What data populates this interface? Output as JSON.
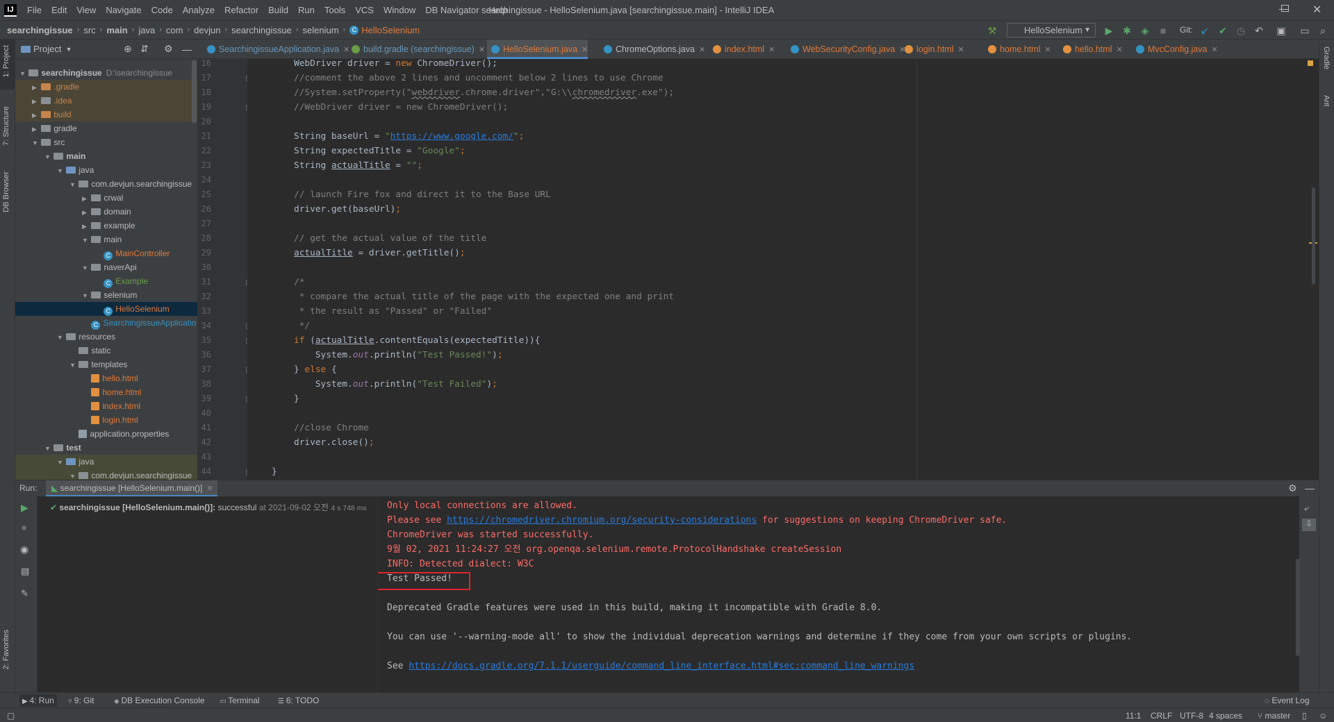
{
  "menu": [
    "File",
    "Edit",
    "View",
    "Navigate",
    "Code",
    "Analyze",
    "Refactor",
    "Build",
    "Run",
    "Tools",
    "VCS",
    "Window",
    "DB Navigator",
    "Help"
  ],
  "window_title": "searchingissue - HelloSelenium.java [searchingissue.main] - IntelliJ IDEA",
  "breadcrumbs": [
    "searchingissue",
    "src",
    "main",
    "java",
    "com",
    "devjun",
    "searchingissue",
    "selenium",
    "HelloSelenium"
  ],
  "run_config": "HelloSelenium",
  "git_label": "Git:",
  "left_strip": {
    "project": "1: Project",
    "structure": "7: Structure",
    "db": "DB Browser",
    "favorites": "2: Favorites"
  },
  "right_strip": {
    "gradle": "Gradle",
    "ant": "Ant"
  },
  "project_panel": {
    "title": "Project"
  },
  "tree": [
    {
      "label": "searchingissue",
      "extra": "D:\\searchingissue",
      "icon": "folder",
      "arrow": "▼",
      "indent": 0,
      "bold": true
    },
    {
      "label": ".gradle",
      "icon": "folder-orange",
      "arrow": "▶",
      "indent": 1,
      "color": "#c6854d",
      "bg": "orange"
    },
    {
      "label": ".idea",
      "icon": "folder",
      "arrow": "▶",
      "indent": 1,
      "color": "#c6854d",
      "bg": "orange"
    },
    {
      "label": "build",
      "icon": "folder-orange",
      "arrow": "▶",
      "indent": 1,
      "color": "#c6854d",
      "bg": "orange"
    },
    {
      "label": "gradle",
      "icon": "folder",
      "arrow": "▶",
      "indent": 1
    },
    {
      "label": "src",
      "icon": "folder",
      "arrow": "▼",
      "indent": 1
    },
    {
      "label": "main",
      "icon": "folder",
      "arrow": "▼",
      "indent": 2,
      "bold": true
    },
    {
      "label": "java",
      "icon": "folder-blue",
      "arrow": "▼",
      "indent": 3
    },
    {
      "label": "com.devjun.searchingissue",
      "icon": "folder",
      "arrow": "▼",
      "indent": 4
    },
    {
      "label": "crwal",
      "icon": "folder",
      "arrow": "▶",
      "indent": 5
    },
    {
      "label": "domain",
      "icon": "folder",
      "arrow": "▶",
      "indent": 5
    },
    {
      "label": "example",
      "icon": "folder",
      "arrow": "▶",
      "indent": 5
    },
    {
      "label": "main",
      "icon": "folder",
      "arrow": "▼",
      "indent": 5
    },
    {
      "label": "MainController",
      "icon": "class",
      "arrow": "",
      "indent": 6,
      "color": "#e0793a"
    },
    {
      "label": "naverApi",
      "icon": "folder",
      "arrow": "▼",
      "indent": 5
    },
    {
      "label": "Example",
      "icon": "class",
      "arrow": "",
      "indent": 6,
      "color": "#6a9c4a"
    },
    {
      "label": "selenium",
      "icon": "folder",
      "arrow": "▼",
      "indent": 5
    },
    {
      "label": "HelloSelenium",
      "icon": "class",
      "arrow": "",
      "indent": 6,
      "color": "#e0793a",
      "bg": "sel"
    },
    {
      "label": "SearchingissueApplicatio",
      "icon": "class",
      "arrow": "",
      "indent": 5,
      "color": "#3592c4"
    },
    {
      "label": "resources",
      "icon": "folder",
      "arrow": "▼",
      "indent": 3
    },
    {
      "label": "static",
      "icon": "folder",
      "arrow": "",
      "indent": 4
    },
    {
      "label": "templates",
      "icon": "folder",
      "arrow": "▼",
      "indent": 4
    },
    {
      "label": "hello.html",
      "icon": "html",
      "arrow": "",
      "indent": 5,
      "color": "#e0793a"
    },
    {
      "label": "home.html",
      "icon": "html",
      "arrow": "",
      "indent": 5,
      "color": "#e0793a"
    },
    {
      "label": "index.html",
      "icon": "html",
      "arrow": "",
      "indent": 5,
      "color": "#e0793a"
    },
    {
      "label": "login.html",
      "icon": "html",
      "arrow": "",
      "indent": 5,
      "color": "#e0793a"
    },
    {
      "label": "application.properties",
      "icon": "prop",
      "arrow": "",
      "indent": 4
    },
    {
      "label": "test",
      "icon": "folder",
      "arrow": "▼",
      "indent": 2,
      "bold": true
    },
    {
      "label": "java",
      "icon": "folder-blue",
      "arrow": "▼",
      "indent": 3,
      "bg": "green"
    },
    {
      "label": "com.devjun.searchingissue",
      "icon": "folder",
      "arrow": "▼",
      "indent": 4,
      "bg": "green"
    }
  ],
  "tabs": [
    {
      "label": "SearchingissueApplication.java",
      "icon": "#3592c4",
      "color": "#6897bb"
    },
    {
      "label": "build.gradle (searchingissue)",
      "icon": "#6a9c4a",
      "color": "#6897bb"
    },
    {
      "label": "HelloSelenium.java",
      "icon": "#3592c4",
      "color": "#e0793a",
      "active": true
    },
    {
      "label": "ChromeOptions.java",
      "icon": "#3592c4",
      "color": "#bbbbbb"
    },
    {
      "label": "index.html",
      "icon": "#e19040",
      "color": "#e0793a"
    },
    {
      "label": "WebSecurityConfig.java",
      "icon": "#3592c4",
      "color": "#e0793a"
    },
    {
      "label": "login.html",
      "icon": "#e19040",
      "color": "#e0793a"
    },
    {
      "label": "home.html",
      "icon": "#e19040",
      "color": "#e0793a"
    },
    {
      "label": "hello.html",
      "icon": "#e19040",
      "color": "#e0793a"
    },
    {
      "label": "MvcConfig.java",
      "icon": "#3592c4",
      "color": "#e0793a"
    }
  ],
  "code_lines": [
    {
      "n": "16",
      "html": "<span class=\"n\">WebDriver driver = </span><span class=\"kw\">new</span> ChromeDriver();"
    },
    {
      "n": "17",
      "html": "<span class=\"cm\">//comment the above 2 lines and uncomment below 2 lines to use Chrome</span>"
    },
    {
      "n": "18",
      "html": "<span class=\"cm\">//System.setProperty(\"<span class=\"wv\">webdriver</span>.chrome.driver\",\"G:\\\\<span class=\"wv\">chromedriver</span>.exe\");</span>"
    },
    {
      "n": "19",
      "html": "<span class=\"cm\">//WebDriver driver = new ChromeDriver();</span>"
    },
    {
      "n": "20",
      "html": ""
    },
    {
      "n": "21",
      "html": "String baseUrl = <span class=\"str\">\"<span class=\"lk\">https://www.google.com/</span>\"</span><span class=\"kw\">;</span>"
    },
    {
      "n": "22",
      "html": "String expectedTitle = <span class=\"str\">\"Google\"</span><span class=\"kw\">;</span>"
    },
    {
      "n": "23",
      "html": "String <span class=\"ul\">actualTitle</span> = <span class=\"str\">\"\"</span><span class=\"kw\">;</span>"
    },
    {
      "n": "24",
      "html": ""
    },
    {
      "n": "25",
      "html": "<span class=\"cm\">// launch Fire fox and direct it to the Base URL</span>"
    },
    {
      "n": "26",
      "html": "driver.get(baseUrl)<span class=\"kw\">;</span>"
    },
    {
      "n": "27",
      "html": ""
    },
    {
      "n": "28",
      "html": "<span class=\"cm\">// get the actual value of the title</span>"
    },
    {
      "n": "29",
      "html": "<span class=\"ul\">actualTitle</span> = driver.getTitle()<span class=\"kw\">;</span>"
    },
    {
      "n": "30",
      "html": ""
    },
    {
      "n": "31",
      "html": "<span class=\"cm\">/*</span>"
    },
    {
      "n": "32",
      "html": "<span class=\"cm\"> * compare the actual title of the page with the expected one and print</span>"
    },
    {
      "n": "33",
      "html": "<span class=\"cm\"> * the result as \"Passed\" or \"Failed\"</span>"
    },
    {
      "n": "34",
      "html": "<span class=\"cm\"> */</span>"
    },
    {
      "n": "35",
      "html": "<span class=\"kw\">if</span> (<span class=\"ul\">actualTitle</span>.contentEquals(expectedTitle)){"
    },
    {
      "n": "36",
      "html": "    System.<span class=\"it\">out</span>.println(<span class=\"str\">\"Test Passed!\"</span>)<span class=\"kw\">;</span>"
    },
    {
      "n": "37",
      "html": "} <span class=\"kw\">else</span> {"
    },
    {
      "n": "38",
      "html": "    System.<span class=\"it\">out</span>.println(<span class=\"str\">\"Test Failed\"</span>)<span class=\"kw\">;</span>"
    },
    {
      "n": "39",
      "html": "}"
    },
    {
      "n": "40",
      "html": ""
    },
    {
      "n": "41",
      "html": "<span class=\"cm\">//close Chrome</span>"
    },
    {
      "n": "42",
      "html": "driver.close()<span class=\"kw\">;</span>"
    },
    {
      "n": "43",
      "html": ""
    },
    {
      "n": "44",
      "html": "}"
    }
  ],
  "run": {
    "label": "Run:",
    "tab": "searchingissue [HelloSelenium.main()]",
    "tree_item": "searchingissue [HelloSelenium.main()]:",
    "tree_status": "successful",
    "tree_time": "at 2021-09-02 오전",
    "tree_duration": "4 s 748 ms"
  },
  "console": [
    {
      "text": "Only local connections are allowed.",
      "red": true
    },
    {
      "text": "Please see ",
      "red": true,
      "link": "https://chromedriver.chromium.org/security-considerations",
      "after": " for suggestions on keeping ChromeDriver safe."
    },
    {
      "text": "ChromeDriver was started successfully.",
      "red": true
    },
    {
      "text": "9월 02, 2021 11:24:27 오전 org.openqa.selenium.remote.ProtocolHandshake createSession",
      "red": true
    },
    {
      "text": "INFO: Detected dialect: W3C",
      "red": true
    },
    {
      "text": "Test Passed!",
      "red": false
    },
    {
      "text": "",
      "red": false
    },
    {
      "text": "Deprecated Gradle features were used in this build, making it incompatible with Gradle 8.0.",
      "red": false
    },
    {
      "text": "",
      "red": false
    },
    {
      "text": "You can use '--warning-mode all' to show the individual deprecation warnings and determine if they come from your own scripts or plugins.",
      "red": false
    },
    {
      "text": "",
      "red": false
    },
    {
      "text": "See ",
      "red": false,
      "link": "https://docs.gradle.org/7.1.1/userguide/command_line_interface.html#sec:command_line_warnings",
      "after": ""
    }
  ],
  "bottom_tools": [
    "4: Run",
    "9: Git",
    "DB Execution Console",
    "Terminal",
    "6: TODO"
  ],
  "event_log": "Event Log",
  "status": {
    "pos": "11:1",
    "eol": "CRLF",
    "enc": "UTF-8",
    "indent": "4 spaces",
    "branch": "master"
  }
}
